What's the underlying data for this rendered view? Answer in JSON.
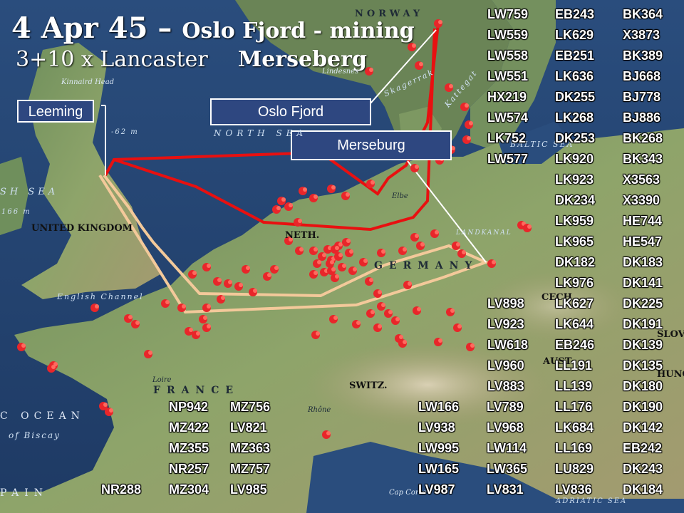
{
  "title": {
    "date": "4 Apr 45",
    "dash": "–",
    "mission": "Oslo Fjord - mining",
    "force": "3+10 x Lancaster",
    "target2": "Merseberg"
  },
  "boxes": {
    "leeming": "Leeming",
    "oslo": "Oslo Fjord",
    "merseburg": "Merseburg"
  },
  "map_labels": {
    "norway": "NORWAY",
    "north_sea": "NORTH SEA",
    "irish_sea": "SH SEA",
    "depth1": "-62 m",
    "depth2": "166 m",
    "uk": "UNITED KINGDOM",
    "neth": "NETH.",
    "germany": "GERMANY",
    "france": "FRANCE",
    "ocean": "C OCEAN",
    "biscay": "of Biscay",
    "spain": "PAIN",
    "switz": "SWITZ.",
    "english_channel": "English Channel",
    "kinnaird": "Kinnaird Head",
    "lindesnes": "Lindesnes",
    "skagerrak": "Skagerrak",
    "kattegat": "Kattegat",
    "baltic": "BALTIC SEA",
    "landkanal": "LANDKANAL",
    "adriatic": "ADRIATIC SEA",
    "cap_corse": "Cap Corse",
    "loire": "Loire",
    "rhone": "Rhône",
    "elbe": "Elbe",
    "slov": "SLOV.",
    "hung": "HUNG.",
    "aust": "AUST",
    "czech": "CECH"
  },
  "colors": {
    "oslo_route": "#e81010",
    "merseburg_route": "#f3c99a",
    "target_marker": "#e8262a",
    "box_fill": "#2e4780"
  },
  "serials": {
    "col1": [
      "LW759",
      "LW559",
      "LW558",
      "LW551",
      "HX219",
      "LW574",
      "LK752",
      "LW577"
    ],
    "col2": [
      "EB243",
      "LK629",
      "EB251",
      "LK636",
      "DK255",
      "LK268",
      "DK253",
      "LK920",
      "LK923",
      "DK234",
      "LK959",
      "LK965",
      "DK182",
      "LK976"
    ],
    "col3": [
      "BK364",
      "X3873",
      "BK389",
      "BJ668",
      "BJ778",
      "BJ886",
      "BK268",
      "BK343",
      "X3563",
      "X3390",
      "HE744",
      "HE547",
      "DK183",
      "DK141",
      "DK225",
      "DK191",
      "DK139",
      "DK135",
      "DK180",
      "DK190",
      "DK142",
      "EB242",
      "DK243",
      "DK184"
    ],
    "col_lv": [
      "LV898",
      "LV923",
      "LW618",
      "LV960",
      "LV883"
    ],
    "col_lk": [
      "LK627",
      "LK644",
      "EB246",
      "LL191",
      "LL139",
      "LL176",
      "LK684",
      "LL169",
      "LU829",
      "LV836"
    ],
    "col_lw": [
      "LW166",
      "LV938",
      "LW995",
      "LW165",
      "LV987"
    ],
    "col_lv2": [
      "LV789",
      "LV968",
      "LW114",
      "LW365",
      "LV831"
    ],
    "france_a": [
      "NP942",
      "MZ422",
      "MZ355",
      "NR257",
      "MZ304"
    ],
    "france_b": [
      "MZ756",
      "LV821",
      "MZ363",
      "MZ757",
      "LV985"
    ],
    "france_c": [
      "NR288"
    ]
  }
}
